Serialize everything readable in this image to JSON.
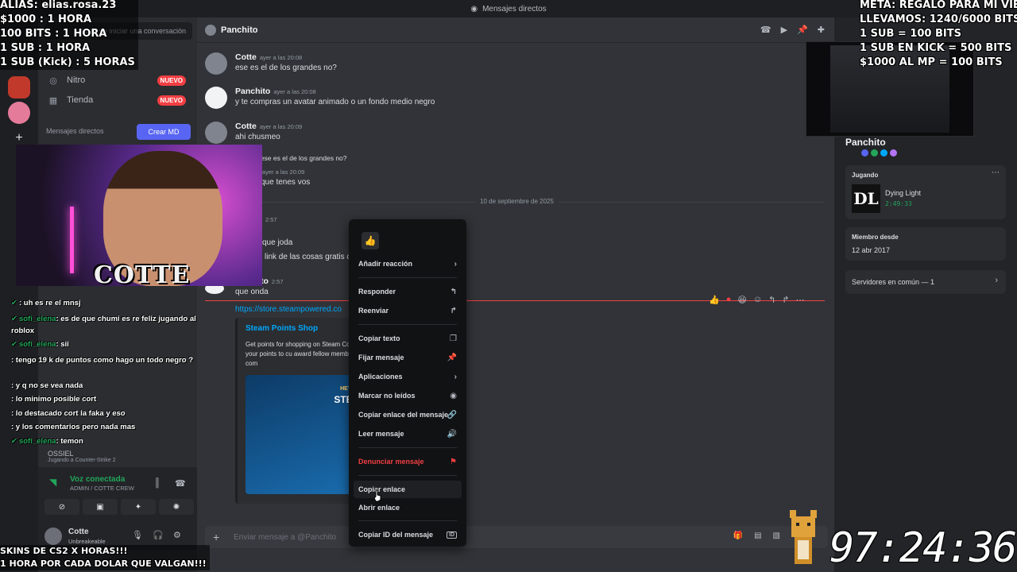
{
  "titlebar": {
    "title": "Mensajes directos"
  },
  "sidebar": {
    "search_placeholder": "Buscar o iniciar una conversación",
    "items": [
      {
        "label": "Nitro",
        "badge": "NUEVO"
      },
      {
        "label": "Tienda",
        "badge": "NUEVO"
      }
    ],
    "dm_header": "Mensajes directos",
    "create_dm": "Crear MD"
  },
  "voice": {
    "status": "Voz conectada",
    "channel": "ADMIN / COTTE CREW"
  },
  "user": {
    "name": "Cotte",
    "status": "Unbreakeable"
  },
  "chat": {
    "channel_name": "Panchito",
    "messages": [
      {
        "author": "Cotte",
        "time": "ayer a las 20:08",
        "text": "ese es el de los grandes no?"
      },
      {
        "author": "Panchito",
        "time": "ayer a las 20:08",
        "text": "y te compras un avatar animado o un fondo medio negro"
      },
      {
        "author": "Cotte",
        "time": "ayer a las 20:09",
        "text": "ahi chusmeo"
      },
      {
        "author": "tte",
        "time": "",
        "text": "ese es el de los grandes no?"
      },
      {
        "author": "to",
        "time": "ayer a las 20:09",
        "text": "que tenes vos"
      },
      {
        "author": "",
        "time": "2:57",
        "text": "que joda"
      },
      {
        "author": "",
        "time": "",
        "text": "l link de las cosas gratis c"
      },
      {
        "author": "to",
        "time": "2:57",
        "text": "que onda"
      }
    ],
    "date_divider": "10 de septiembre de 2025",
    "link": "https://store.steampowered.co",
    "embed": {
      "title": "Steam Points Shop",
      "description": "Get points for shopping on Steam Community. Use your points to cu award fellow members of the com",
      "image_caption_small": "HEY LOOK, IT'S",
      "image_caption_big": "STEAM PO"
    },
    "composer_placeholder": "Enviar mensaje a @Panchito"
  },
  "context_menu": {
    "reaction": "👍",
    "items": [
      {
        "label": "Añadir reacción",
        "icon": "›"
      },
      {
        "label": "Responder",
        "icon": "↰"
      },
      {
        "label": "Reenviar",
        "icon": "↱"
      },
      {
        "label": "Copiar texto",
        "icon": "❐"
      },
      {
        "label": "Fijar mensaje",
        "icon": "📌"
      },
      {
        "label": "Aplicaciones",
        "icon": "›"
      },
      {
        "label": "Marcar no leídos",
        "icon": "◉"
      },
      {
        "label": "Copiar enlace del mensaje",
        "icon": "🔗"
      },
      {
        "label": "Leer mensaje",
        "icon": "🔊"
      },
      {
        "label": "Denunciar mensaje",
        "icon": "⚑"
      },
      {
        "label": "Copiar enlace",
        "icon": ""
      },
      {
        "label": "Abrir enlace",
        "icon": ""
      },
      {
        "label": "Copiar ID del mensaje",
        "icon": "ID"
      }
    ]
  },
  "profile": {
    "name": "Panchito",
    "activity_header": "Jugando",
    "game_logo": "DL",
    "game_name": "Dying Light",
    "game_time": "2:49:33",
    "member_since_label": "Miembro desde",
    "member_since": "12 abr 2017",
    "servers_common": "Servidores en común — 1"
  },
  "overlay": {
    "left_lines": [
      "ALIAS: elias.rosa.23",
      "$1000 : 1 HORA",
      "100 BITS : 1 HORA",
      "1 SUB : 1 HORA",
      "1 SUB (Kick) : 5 HORAS"
    ],
    "right_lines": [
      "META: REGALO PARA MI VIEJA",
      "LLEVAMOS: 1240/6000 BITS",
      "1 SUB = 100 BITS",
      "1 SUB EN KICK = 500 BITS",
      "$1000 AL MP = 100 BITS"
    ],
    "bottom_lines": [
      "SKINS DE CS2 X HORAS!!!",
      "1 HORA POR CADA DOLAR QUE VALGAN!!!"
    ],
    "timer": "97:24:36",
    "logo": "COTTE"
  },
  "stream_chat": [
    {
      "user": "",
      "text": ": uh es re  el mnsj"
    },
    {
      "user": "sofi_elena",
      "text": ": es de que chumi es re feliz jugando al roblox"
    },
    {
      "user": "sofi_elena",
      "text": ": sii"
    },
    {
      "user": "",
      "text": ": tengo 19 k de puntos como hago un todo negro ?"
    },
    {
      "user": "",
      "text": ": y q no se vea nada"
    },
    {
      "user": "",
      "text": ": lo minimo posible cort"
    },
    {
      "user": "",
      "text": ": lo destacado cort la faka y eso"
    },
    {
      "user": "",
      "text": ": y los comentarios pero nada mas"
    },
    {
      "user": "sofi_elena",
      "text": ": temon"
    }
  ],
  "dm_list_partial": {
    "name": "OSSIEL",
    "activity": "Jugando a Counter-Strike 2"
  }
}
